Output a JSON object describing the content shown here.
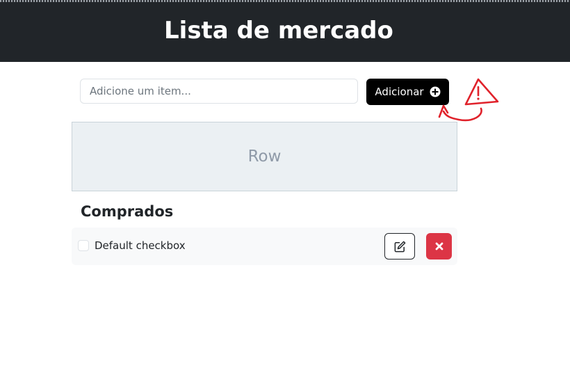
{
  "header": {
    "title": "Lista de mercado"
  },
  "form": {
    "input_placeholder": "Adicione um item...",
    "input_value": "",
    "add_label": "Adicionar",
    "add_icon": "plus-circle-icon"
  },
  "annotation": {
    "icon": "warning-triangle-icon",
    "color": "#e0222b"
  },
  "row_placeholder": {
    "label": "Row"
  },
  "purchased": {
    "title": "Comprados",
    "items": [
      {
        "label": "Default checkbox",
        "checked": false,
        "edit_icon": "edit-icon",
        "delete_icon": "close-icon"
      }
    ]
  },
  "colors": {
    "header_bg": "#212529",
    "add_button_bg": "#000000",
    "delete_button_bg": "#dc3545",
    "row_box_bg": "#ebf0f3"
  }
}
